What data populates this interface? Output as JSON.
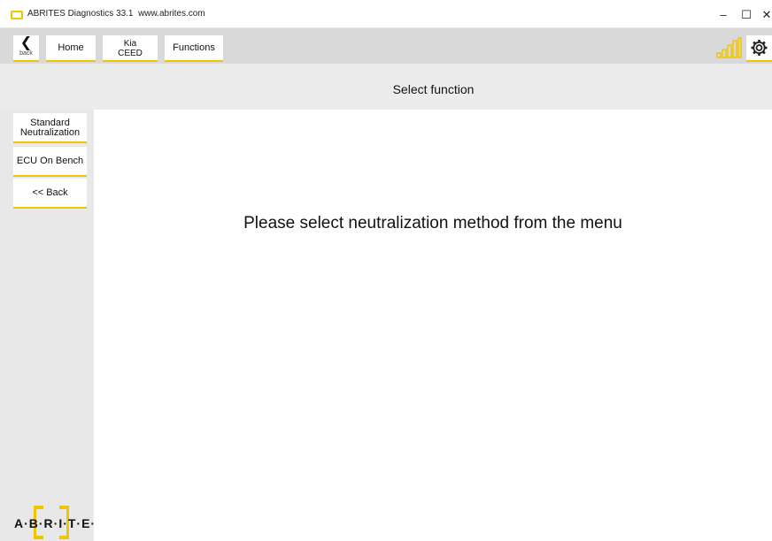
{
  "window": {
    "title": "ABRITES Diagnostics 33.1",
    "url": "www.abrites.com",
    "minimize_glyph": "–",
    "maximize_glyph": "☐",
    "close_glyph": "✕"
  },
  "toolbar": {
    "back_label": "back",
    "back_glyph": "❮",
    "home_label": "Home",
    "vehicle_make": "Kia",
    "vehicle_model": "CEED",
    "functions_label": "Functions",
    "signal_icon": "signal-strength-icon",
    "settings_icon": "gear-icon"
  },
  "header": {
    "title": "Select function"
  },
  "sidebar": {
    "items": [
      {
        "label_line1": "Standard",
        "label_line2": "Neutralization"
      },
      {
        "label": "ECU On Bench"
      },
      {
        "label": "<< Back"
      }
    ],
    "logo_text": "A·B·R·I·T·E·S"
  },
  "main": {
    "message": "Please select neutralization method from the menu"
  },
  "colors": {
    "accent": "#f2c400",
    "toolbar_bg": "#d9d9d9",
    "header_bg": "#ececec",
    "sidebar_bg": "#e8e8e8"
  }
}
